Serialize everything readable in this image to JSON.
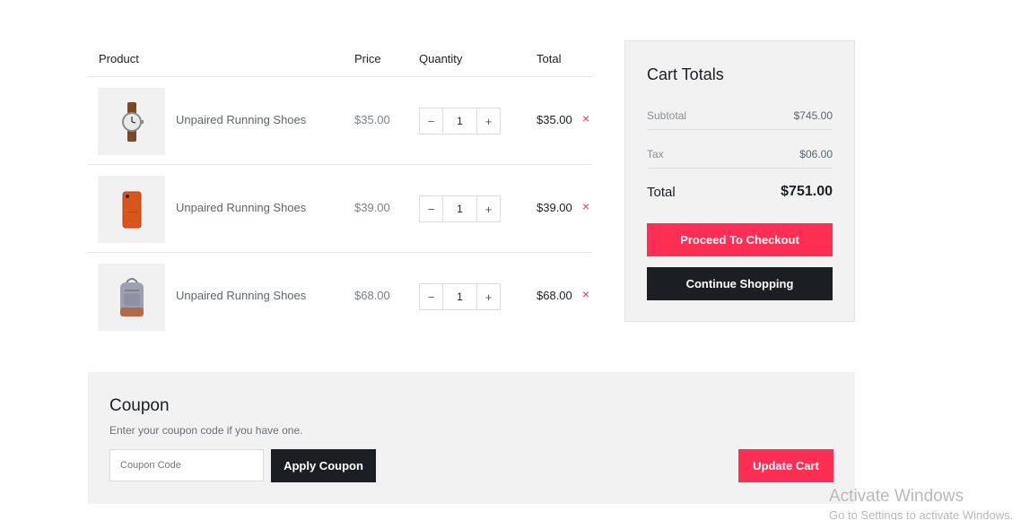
{
  "cart": {
    "headers": {
      "product": "Product",
      "price": "Price",
      "quantity": "Quantity",
      "total": "Total"
    },
    "items": [
      {
        "name": "Unpaired Running Shoes",
        "price": "$35.00",
        "quantity": "1",
        "total": "$35.00",
        "image_icon": "watch-icon",
        "remove_symbol": "×"
      },
      {
        "name": "Unpaired Running Shoes",
        "price": "$39.00",
        "quantity": "1",
        "total": "$39.00",
        "image_icon": "phone-case-icon",
        "remove_symbol": "×"
      },
      {
        "name": "Unpaired Running Shoes",
        "price": "$68.00",
        "quantity": "1",
        "total": "$68.00",
        "image_icon": "backpack-icon",
        "remove_symbol": "×"
      }
    ],
    "qty_minus": "−",
    "qty_plus": "+"
  },
  "totals": {
    "title": "Cart Totals",
    "subtotal_label": "Subtotal",
    "subtotal_value": "$745.00",
    "tax_label": "Tax",
    "tax_value": "$06.00",
    "total_label": "Total",
    "total_value": "$751.00",
    "checkout_label": "Proceed To Checkout",
    "continue_label": "Continue Shopping"
  },
  "coupon": {
    "title": "Coupon",
    "description": "Enter your coupon code if you have one.",
    "placeholder": "Coupon Code",
    "value": "",
    "apply_label": "Apply Coupon",
    "update_label": "Update Cart"
  },
  "watermark": {
    "line1": "Activate Windows",
    "line2": "Go to Settings to activate Windows."
  },
  "colors": {
    "accent": "#ff2e52",
    "dark": "#1b1f24",
    "panel": "#f2f2f2"
  }
}
